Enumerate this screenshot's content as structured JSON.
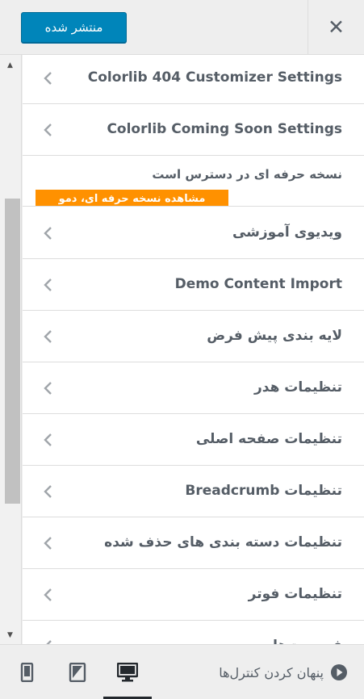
{
  "header": {
    "publish_label": "منتشر شده",
    "close_icon": "close-icon"
  },
  "sections": [
    {
      "label": "Colorlib 404 Customizer Settings",
      "rtl": false
    },
    {
      "label": "Colorlib Coming Soon Settings",
      "rtl": false
    },
    {
      "label": "ویدیوی آموزشی",
      "rtl": true
    },
    {
      "label": "Demo Content Import",
      "rtl": false
    },
    {
      "label": "لایه بندی پیش فرض",
      "rtl": true
    },
    {
      "label": "تنظیمات هدر",
      "rtl": true
    },
    {
      "label": "تنظیمات صفحه اصلی",
      "rtl": true
    },
    {
      "label": "تنظیمات Breadcrumb",
      "rtl": true
    },
    {
      "label": "تنظیمات دسته بندی های حذف شده",
      "rtl": true
    },
    {
      "label": "تنظیمات فوتر",
      "rtl": true
    },
    {
      "label": "فهرست‌ها",
      "rtl": true
    }
  ],
  "pro_notice": {
    "text": "نسخه حرفه ای در دسترس است",
    "button_label": "مشاهده نسخه حرفه ای، دمو"
  },
  "footer": {
    "hide_controls_label": "پنهان کردن کنترل‌ها",
    "devices": [
      "mobile-icon",
      "tablet-icon",
      "desktop-icon"
    ],
    "active_device": "desktop"
  },
  "colors": {
    "publish": "#0085ba",
    "pro_button": "#ff9100",
    "text": "#555d66"
  }
}
